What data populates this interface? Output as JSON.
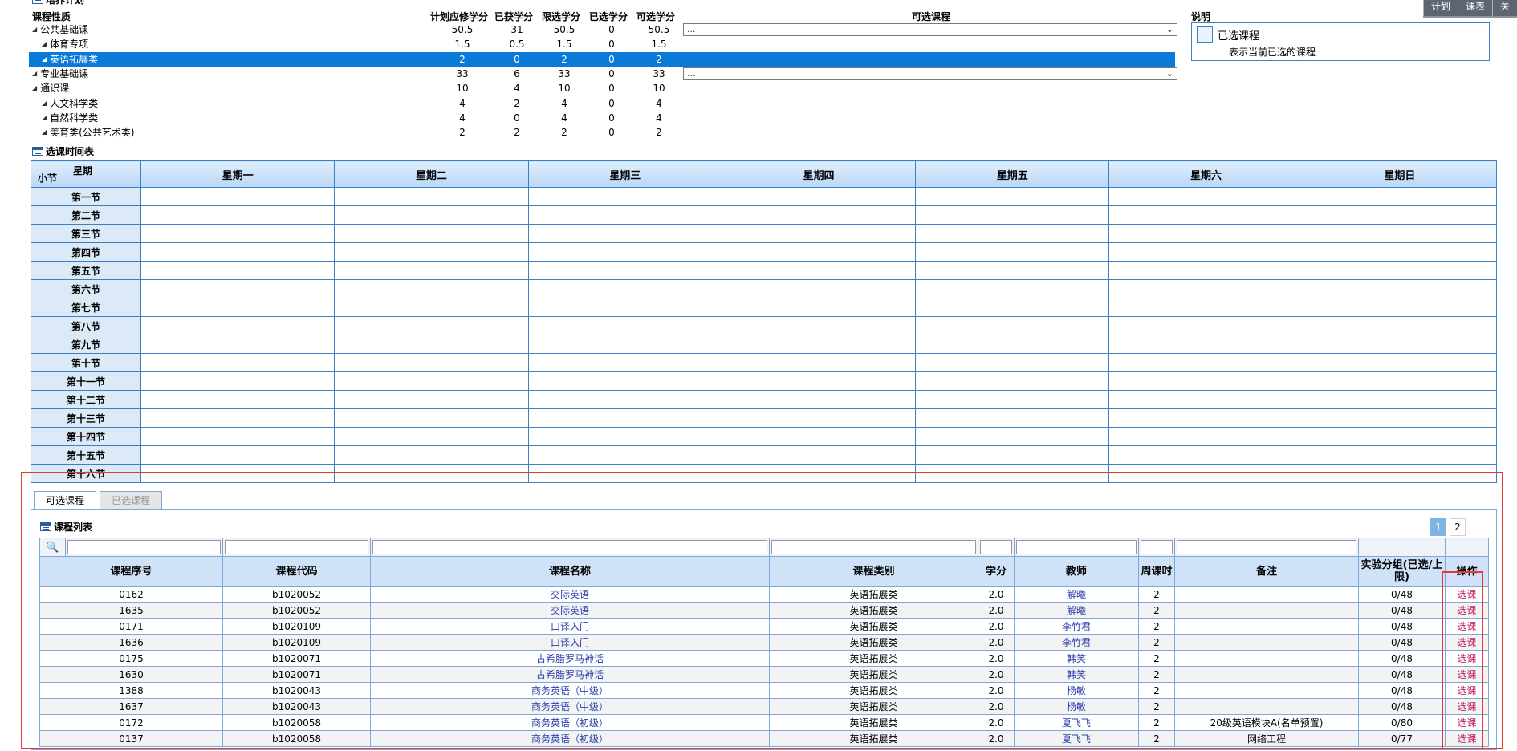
{
  "topbar": {
    "buttons": [
      "计划",
      "课表",
      "关"
    ]
  },
  "plan": {
    "section_title": "培养计划",
    "head_nature": "课程性质",
    "columns": [
      "计划应修学分",
      "已获学分",
      "限选学分",
      "已选学分",
      "可选学分"
    ],
    "optional_header": "可选课程",
    "rows": [
      {
        "name": "公共基础课",
        "level": 0,
        "values": [
          "50.5",
          "31",
          "50.5",
          "0",
          "50.5"
        ],
        "has_select": true,
        "select_text": "...",
        "selected": false
      },
      {
        "name": "体育专项",
        "level": 1,
        "values": [
          "1.5",
          "0.5",
          "1.5",
          "0",
          "1.5"
        ],
        "has_select": false,
        "selected": false
      },
      {
        "name": "英语拓展类",
        "level": 1,
        "values": [
          "2",
          "0",
          "2",
          "0",
          "2"
        ],
        "has_select": false,
        "selected": true
      },
      {
        "name": "专业基础课",
        "level": 0,
        "values": [
          "33",
          "6",
          "33",
          "0",
          "33"
        ],
        "has_select": true,
        "select_text": "...",
        "selected": false
      },
      {
        "name": "通识课",
        "level": 0,
        "values": [
          "10",
          "4",
          "10",
          "0",
          "10"
        ],
        "has_select": false,
        "selected": false
      },
      {
        "name": "人文科学类",
        "level": 1,
        "values": [
          "4",
          "2",
          "4",
          "0",
          "4"
        ],
        "has_select": false,
        "selected": false
      },
      {
        "name": "自然科学类",
        "level": 1,
        "values": [
          "4",
          "0",
          "4",
          "0",
          "4"
        ],
        "has_select": false,
        "selected": false
      },
      {
        "name": "美育类(公共艺术类)",
        "level": 1,
        "values": [
          "2",
          "2",
          "2",
          "0",
          "2"
        ],
        "has_select": false,
        "selected": false
      }
    ]
  },
  "legend": {
    "title": "说明",
    "label": "已选课程",
    "desc": "表示当前已选的课程"
  },
  "timetable": {
    "section_title": "选课时间表",
    "corner_top": "星期",
    "corner_bottom": "小节",
    "days": [
      "星期一",
      "星期二",
      "星期三",
      "星期四",
      "星期五",
      "星期六",
      "星期日"
    ],
    "periods": [
      "第一节",
      "第二节",
      "第三节",
      "第四节",
      "第五节",
      "第六节",
      "第七节",
      "第八节",
      "第九节",
      "第十节",
      "第十一节",
      "第十二节",
      "第十三节",
      "第十四节",
      "第十五节",
      "第十六节"
    ]
  },
  "courses": {
    "tabs": [
      "可选课程",
      "已选课程"
    ],
    "list_title": "课程列表",
    "pages": [
      "1",
      "2"
    ],
    "headers": [
      "课程序号",
      "课程代码",
      "课程名称",
      "课程类别",
      "学分",
      "教师",
      "周课时",
      "备注",
      "实验分组(已选/上限)",
      "操作"
    ],
    "rows": [
      [
        "0162",
        "b1020052",
        "交际英语",
        "英语拓展类",
        "2.0",
        "解曦",
        "2",
        "",
        "0/48",
        "选课"
      ],
      [
        "1635",
        "b1020052",
        "交际英语",
        "英语拓展类",
        "2.0",
        "解曦",
        "2",
        "",
        "0/48",
        "选课"
      ],
      [
        "0171",
        "b1020109",
        "口译入门",
        "英语拓展类",
        "2.0",
        "李竹君",
        "2",
        "",
        "0/48",
        "选课"
      ],
      [
        "1636",
        "b1020109",
        "口译入门",
        "英语拓展类",
        "2.0",
        "李竹君",
        "2",
        "",
        "0/48",
        "选课"
      ],
      [
        "0175",
        "b1020071",
        "古希腊罗马神话",
        "英语拓展类",
        "2.0",
        "韩笑",
        "2",
        "",
        "0/48",
        "选课"
      ],
      [
        "1630",
        "b1020071",
        "古希腊罗马神话",
        "英语拓展类",
        "2.0",
        "韩笑",
        "2",
        "",
        "0/48",
        "选课"
      ],
      [
        "1388",
        "b1020043",
        "商务英语（中级）",
        "英语拓展类",
        "2.0",
        "杨敏",
        "2",
        "",
        "0/48",
        "选课"
      ],
      [
        "1637",
        "b1020043",
        "商务英语（中级）",
        "英语拓展类",
        "2.0",
        "杨敏",
        "2",
        "",
        "0/48",
        "选课"
      ],
      [
        "0172",
        "b1020058",
        "商务英语（初级）",
        "英语拓展类",
        "2.0",
        "夏飞飞",
        "2",
        "20级英语模块A(名单预置)",
        "0/80",
        "选课"
      ],
      [
        "0137",
        "b1020058",
        "商务英语（初级）",
        "英语拓展类",
        "2.0",
        "夏飞飞",
        "2",
        "网络工程",
        "0/77",
        "选课"
      ]
    ]
  }
}
